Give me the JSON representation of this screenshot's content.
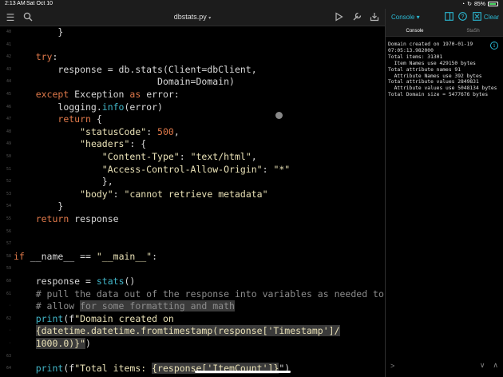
{
  "status": {
    "time": "2:13 AM",
    "date": "Sat Oct 10",
    "battery": "85%",
    "battery_level": 0.85
  },
  "editor": {
    "filename": "dbstats.py",
    "icons": {
      "menu": "sidebar-menu-icon",
      "search": "search-icon",
      "run": "play-icon",
      "tools": "wrench-icon",
      "share": "share-icon"
    },
    "lines": [
      {
        "n": "40",
        "indent": "        ",
        "tokens": [
          {
            "t": "}",
            "c": ""
          }
        ]
      },
      {
        "n": "41",
        "indent": "",
        "tokens": []
      },
      {
        "n": "42",
        "indent": "    ",
        "tokens": [
          {
            "t": "try",
            "c": "k"
          },
          {
            "t": ":",
            "c": ""
          }
        ]
      },
      {
        "n": "43",
        "indent": "        ",
        "tokens": [
          {
            "t": "response = db.stats(Client=dbClient,",
            "c": ""
          }
        ]
      },
      {
        "n": "44",
        "indent": "                          ",
        "tokens": [
          {
            "t": "Domain=Domain)",
            "c": ""
          }
        ]
      },
      {
        "n": "45",
        "indent": "    ",
        "tokens": [
          {
            "t": "except",
            "c": "k"
          },
          {
            "t": " Exception ",
            "c": ""
          },
          {
            "t": "as",
            "c": "k"
          },
          {
            "t": " error:",
            "c": ""
          }
        ]
      },
      {
        "n": "46",
        "indent": "        ",
        "tokens": [
          {
            "t": "logging.",
            "c": ""
          },
          {
            "t": "info",
            "c": "f"
          },
          {
            "t": "(error)",
            "c": ""
          }
        ]
      },
      {
        "n": "47",
        "indent": "        ",
        "tokens": [
          {
            "t": "return",
            "c": "k"
          },
          {
            "t": " {",
            "c": ""
          }
        ]
      },
      {
        "n": "48",
        "indent": "            ",
        "tokens": [
          {
            "t": "\"statusCode\"",
            "c": "s"
          },
          {
            "t": ": ",
            "c": ""
          },
          {
            "t": "500",
            "c": "k"
          },
          {
            "t": ",",
            "c": ""
          }
        ]
      },
      {
        "n": "49",
        "indent": "            ",
        "tokens": [
          {
            "t": "\"headers\"",
            "c": "s"
          },
          {
            "t": ": {",
            "c": ""
          }
        ]
      },
      {
        "n": "50",
        "indent": "                ",
        "tokens": [
          {
            "t": "\"Content-Type\"",
            "c": "s"
          },
          {
            "t": ": ",
            "c": ""
          },
          {
            "t": "\"text/html\"",
            "c": "s"
          },
          {
            "t": ",",
            "c": ""
          }
        ]
      },
      {
        "n": "51",
        "indent": "                ",
        "tokens": [
          {
            "t": "\"Access-Control-Allow-Origin\"",
            "c": "s"
          },
          {
            "t": ": ",
            "c": ""
          },
          {
            "t": "\"*\"",
            "c": "s"
          }
        ]
      },
      {
        "n": "52",
        "indent": "                ",
        "tokens": [
          {
            "t": "},",
            "c": ""
          }
        ]
      },
      {
        "n": "53",
        "indent": "            ",
        "tokens": [
          {
            "t": "\"body\"",
            "c": "s"
          },
          {
            "t": ": ",
            "c": ""
          },
          {
            "t": "\"cannot retrieve metadata\"",
            "c": "s"
          }
        ]
      },
      {
        "n": "54",
        "indent": "        ",
        "tokens": [
          {
            "t": "}",
            "c": ""
          }
        ]
      },
      {
        "n": "55",
        "indent": "    ",
        "tokens": [
          {
            "t": "return",
            "c": "k"
          },
          {
            "t": " response",
            "c": ""
          }
        ]
      },
      {
        "n": "56",
        "indent": "",
        "tokens": []
      },
      {
        "n": "57",
        "indent": "",
        "tokens": []
      },
      {
        "n": "58",
        "indent": "",
        "tokens": [
          {
            "t": "if",
            "c": "k"
          },
          {
            "t": " __name__ == ",
            "c": ""
          },
          {
            "t": "\"__main__\"",
            "c": "s"
          },
          {
            "t": ":",
            "c": ""
          }
        ]
      },
      {
        "n": "59",
        "indent": "",
        "tokens": []
      },
      {
        "n": "60",
        "indent": "    ",
        "tokens": [
          {
            "t": "response = ",
            "c": ""
          },
          {
            "t": "stats",
            "c": "f"
          },
          {
            "t": "()",
            "c": ""
          }
        ]
      },
      {
        "n": "61",
        "indent": "    ",
        "tokens": [
          {
            "t": "# pull the data out of the response into variables as needed to",
            "c": "c"
          }
        ]
      },
      {
        "n": "·",
        "indent": "    ",
        "tokens": [
          {
            "t": "# allow ",
            "c": "c"
          },
          {
            "t": "for some formatting and math",
            "c": "c sel"
          }
        ]
      },
      {
        "n": "62",
        "indent": "    ",
        "tokens": [
          {
            "t": "print",
            "c": "f"
          },
          {
            "t": "(f",
            "c": ""
          },
          {
            "t": "\"Domain created on",
            "c": "s"
          }
        ]
      },
      {
        "n": "·",
        "indent": "    ",
        "tokens": [
          {
            "t": "{datetime.datetime.fromtimestamp(response['Timestamp']/",
            "c": "s sel"
          }
        ]
      },
      {
        "n": "·",
        "indent": "    ",
        "tokens": [
          {
            "t": "1000.0)}\"",
            "c": "s sel"
          },
          {
            "t": ")",
            "c": ""
          }
        ]
      },
      {
        "n": "63",
        "indent": "",
        "tokens": []
      },
      {
        "n": "64",
        "indent": "    ",
        "tokens": [
          {
            "t": "print",
            "c": "f"
          },
          {
            "t": "(f",
            "c": ""
          },
          {
            "t": "\"Total items: ",
            "c": "s"
          },
          {
            "t": "{response['ItemCount']}",
            "c": "s sel"
          },
          {
            "t": "\")",
            "c": ""
          }
        ]
      }
    ]
  },
  "console": {
    "title": "Console",
    "clear_label": "Clear",
    "tabs": [
      {
        "label": "Console",
        "active": true
      },
      {
        "label": "StaSh",
        "active": false
      }
    ],
    "output": "Domain created on 1970-01-19\n07:05:13.982000\nTotal items: 31301\n  Item Names use 429150 bytes\nTotal attribute names 91\n  Attribute Names use 392 bytes\nTotal attribute values 2849831\n  Attribute values use 5048134 bytes\nTotal Domain size = 5477676 bytes",
    "prompt": ">"
  }
}
